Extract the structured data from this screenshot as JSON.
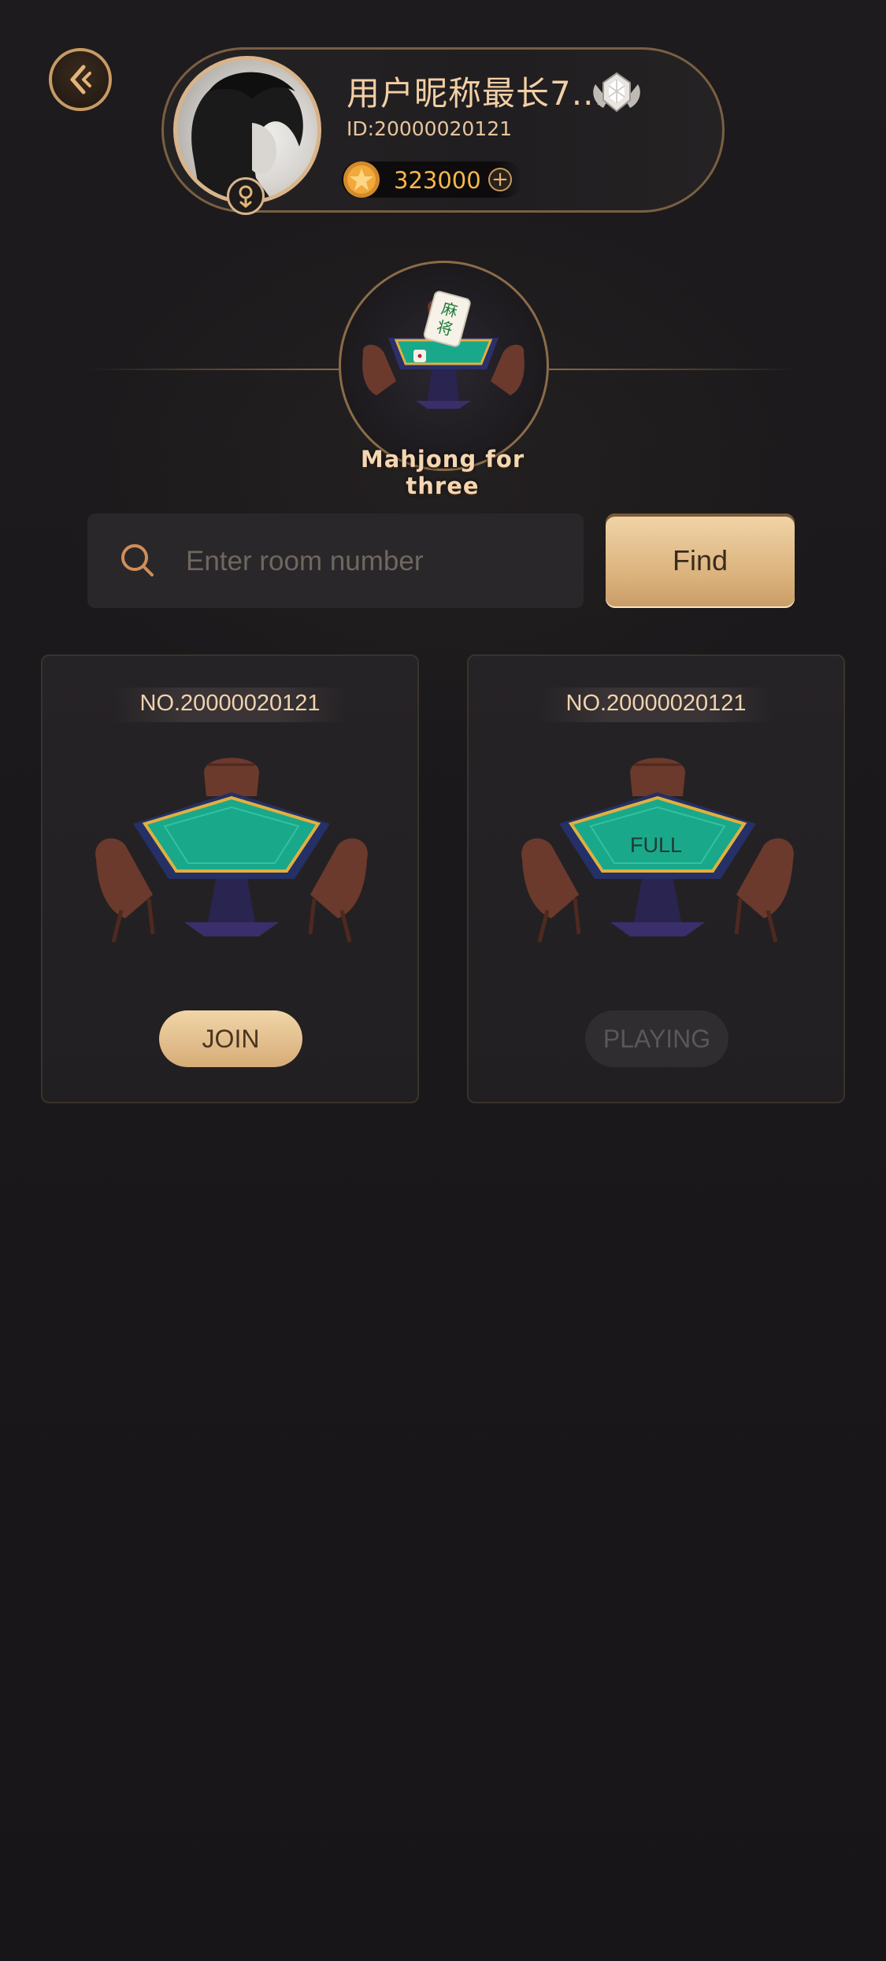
{
  "header": {
    "back_icon": "chevron-left-icon",
    "profile": {
      "nickname": "用户昵称最长7...",
      "user_id": "ID:20000020121",
      "coins": "323000",
      "gender_icon": "female-icon",
      "vip_icon": "diamond-badge-icon"
    }
  },
  "game": {
    "title": "Mahjong for three",
    "tile_text": "麻将"
  },
  "search": {
    "placeholder": "Enter room number",
    "value": "",
    "button_label": "Find"
  },
  "rooms": [
    {
      "number": "NO.20000020121",
      "status_text": "",
      "action_label": "JOIN",
      "action_state": "join"
    },
    {
      "number": "NO.20000020121",
      "status_text": "FULL",
      "action_label": "PLAYING",
      "action_state": "playing"
    }
  ],
  "colors": {
    "background": "#1b191b",
    "gold_accent": "#d9b07a",
    "coin_text": "#f6b84c",
    "table_felt": "#1aa88a"
  }
}
